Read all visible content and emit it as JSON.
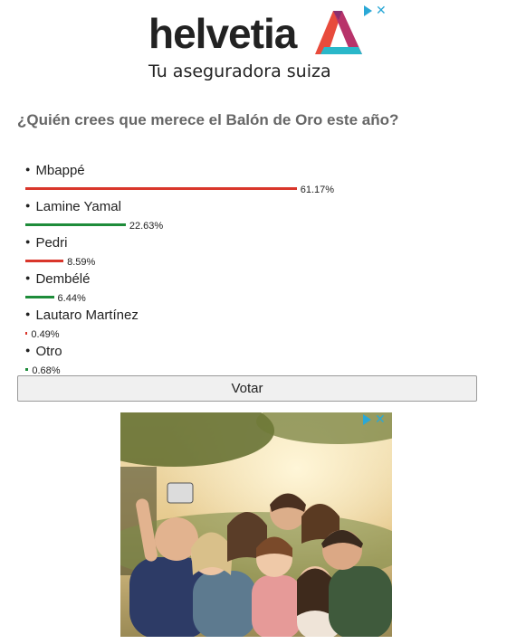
{
  "ad_top": {
    "brand": "helvetia",
    "tagline": "Tu aseguradora suiza",
    "adchoices_icon": "adchoices-icon",
    "close_icon": "close-icon"
  },
  "poll": {
    "question": "¿Quién crees que merece el Balón de Oro este año?",
    "options": [
      {
        "name": "Mbappé",
        "percent_label": "61.17%",
        "percent": 61.17,
        "color": "#d9362b"
      },
      {
        "name": "Lamine Yamal",
        "percent_label": "22.63%",
        "percent": 22.63,
        "color": "#1e8c3a"
      },
      {
        "name": "Pedri",
        "percent_label": "8.59%",
        "percent": 8.59,
        "color": "#d9362b"
      },
      {
        "name": "Dembélé",
        "percent_label": "6.44%",
        "percent": 6.44,
        "color": "#1e8c3a"
      },
      {
        "name": "Lautaro Martínez",
        "percent_label": "0.49%",
        "percent": 0.49,
        "color": "#d9362b"
      },
      {
        "name": "Otro",
        "percent_label": "0.68%",
        "percent": 0.68,
        "color": "#1e8c3a"
      }
    ],
    "vote_label": "Votar"
  },
  "ad_bottom": {
    "image_subject": "family-selfie-photo",
    "adchoices_icon": "adchoices-icon",
    "close_icon": "close-icon"
  }
}
